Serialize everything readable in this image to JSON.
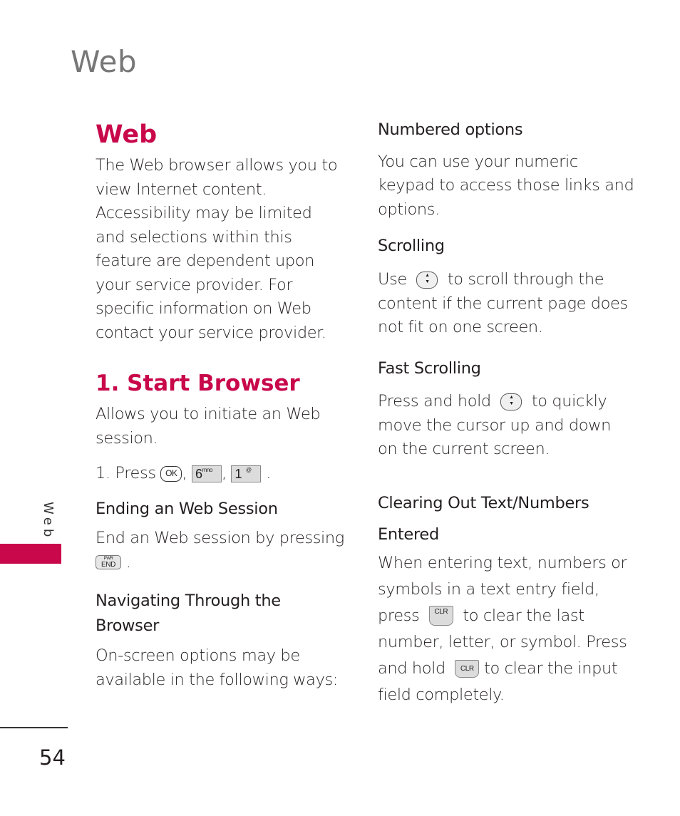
{
  "running_head": "Web",
  "side_tab": {
    "label": "Web",
    "accent_color": "#c8084a"
  },
  "page_number": "54",
  "left_column": {
    "title": "Web",
    "intro": "The Web browser allows you to view Internet content. Accessibility may be limited and selections within this feature are dependent upon your service provider. For specific information on Web contact your service provider.",
    "section_title": "1. Start Browser",
    "section_desc": "Allows you to initiate an Web session.",
    "steps": {
      "prefix": "1. Press",
      "keys": [
        {
          "icon": "ok-key-icon",
          "label": "OK"
        },
        {
          "icon": "6-mno-key-icon",
          "label": "6",
          "sub": "mno"
        },
        {
          "icon": "1-voicemail-key-icon",
          "label": "1",
          "sub": "@"
        }
      ],
      "sep": ",",
      "end": "."
    },
    "ending": {
      "heading": "Ending an Web Session",
      "text": "End an Web session by pressing",
      "key_top": "PWR",
      "key_bottom": "END",
      "end": "."
    },
    "navigating": {
      "heading_line1": "Navigating Through the",
      "heading_line2": "Browser",
      "text": "On-screen options may be available in the following ways:"
    }
  },
  "right_column": {
    "numbered": {
      "heading": "Numbered options",
      "text": "You can use your numeric keypad to access those links and options."
    },
    "scrolling": {
      "heading": "Scrolling",
      "before": "Use",
      "after": "to scroll through the content if the current page does not fit on one screen."
    },
    "fast_scrolling": {
      "heading": "Fast Scrolling",
      "before": "Press and hold",
      "after": "to quickly move the cursor up and down on the current screen."
    },
    "clearing": {
      "heading_line1": "Clearing Out Text/Numbers",
      "heading_line2": "Entered",
      "text1": "When entering text, numbers or symbols in a text entry field, press",
      "text2": "to clear the last number, letter, or symbol. Press and hold",
      "text3": "to clear the input field completely.",
      "key_label": "CLR"
    }
  }
}
